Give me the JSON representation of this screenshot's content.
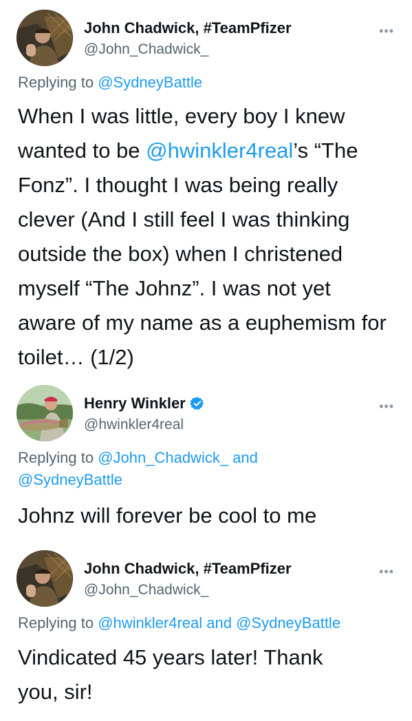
{
  "tweets": [
    {
      "author_name": "John Chadwick, #TeamPfizer",
      "handle": "@John_Chadwick_",
      "verified": false,
      "more_icon": "•••",
      "replying_prefix": "Replying to ",
      "replying_to": [
        "@SydneyBattle"
      ],
      "replying_joiner": "",
      "body_parts": [
        {
          "text": "When I was little, every boy I knew wanted to be ",
          "mention": false
        },
        {
          "text": "@hwinkler4real",
          "mention": true
        },
        {
          "text": "’s “The Fonz”. I thought I was being really clever (And I still feel I was thinking outside the box) when I christened myself “The Johnz”. I was not yet aware of my name as a euphemism for toilet… (1/2)",
          "mention": false
        }
      ]
    },
    {
      "author_name": "Henry Winkler",
      "handle": "@hwinkler4real",
      "verified": true,
      "more_icon": "•••",
      "replying_prefix": "Replying to ",
      "replying_to": [
        "@John_Chadwick_",
        "@SydneyBattle"
      ],
      "replying_joiner": " and ",
      "body_parts": [
        {
          "text": "Johnz will forever be cool to me",
          "mention": false
        }
      ]
    },
    {
      "author_name": "John Chadwick, #TeamPfizer",
      "handle": "@John_Chadwick_",
      "verified": false,
      "more_icon": "•••",
      "replying_prefix": "Replying to ",
      "replying_to": [
        "@hwinkler4real",
        "@SydneyBattle"
      ],
      "replying_joiner": " and ",
      "body_parts": [
        {
          "text": "Vindicated 45 years later! Thank you, sir!",
          "mention": false
        }
      ]
    }
  ],
  "colors": {
    "link": "#1d9bf0",
    "secondary_text": "#536471",
    "primary_text": "#0f1419",
    "verified_badge": "#1d9bf0"
  }
}
